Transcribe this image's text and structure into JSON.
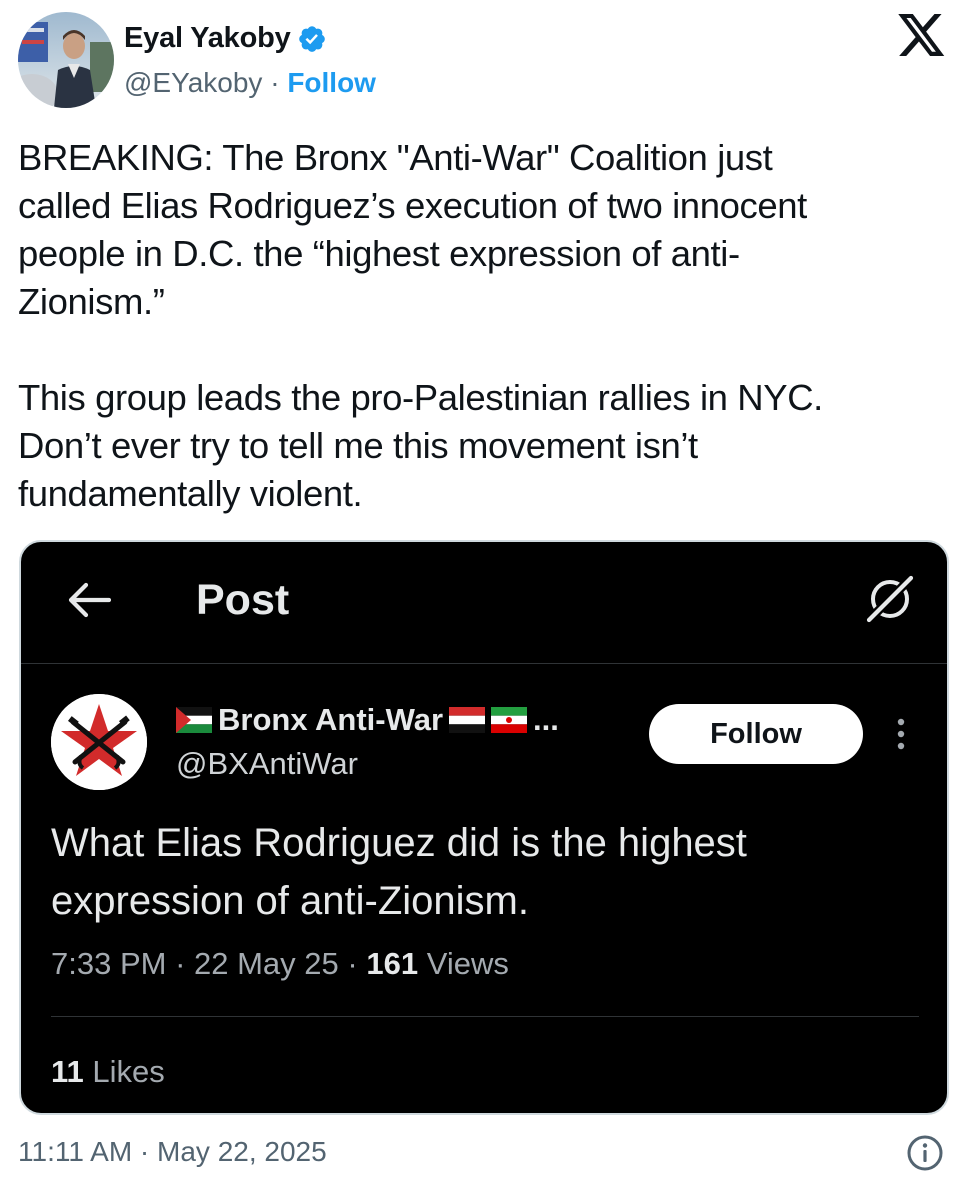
{
  "author": {
    "display_name": "Eyal Yakoby",
    "handle": "@EYakoby",
    "separator": " · ",
    "follow_label": "Follow",
    "verified_icon": "verified-badge-icon",
    "accent_color": "#1d9bf0"
  },
  "platform_logo": "x-logo-icon",
  "tweet": {
    "text": "BREAKING: The Bronx \"Anti-War\" Coalition just\ncalled Elias Rodriguez’s execution of two innocent\npeople in D.C. the “highest expression of anti-\nZionism.”\n\nThis group leads the pro-Palestinian rallies in NYC.\nDon’t ever try to tell me this movement isn’t\nfundamentally violent."
  },
  "embedded_post": {
    "header_title": "Post",
    "back_icon": "arrow-left-icon",
    "grok_icon": "grok-icon",
    "account": {
      "name": "Bronx Anti-War",
      "ellipsis": "...",
      "handle": "@BXAntiWar",
      "flags": [
        "palestine-flag-icon",
        "yemen-flag-icon",
        "iran-flag-icon"
      ]
    },
    "follow_label": "Follow",
    "more_icon": "more-vertical-icon",
    "text": "What Elias Rodriguez did is the highest\nexpression of anti-Zionism.",
    "time": "7:33 PM",
    "date": "22 May 25",
    "views_count": "161",
    "views_label": "Views",
    "likes_count": "11",
    "likes_label": "Likes"
  },
  "footer": {
    "timestamp": "11:11 AM · May 22, 2025",
    "info_icon": "info-icon"
  }
}
